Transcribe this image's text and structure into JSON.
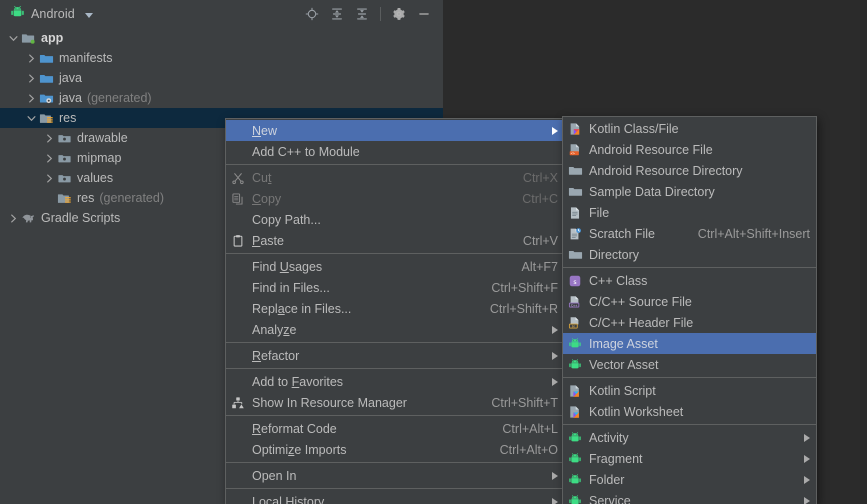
{
  "theme": {
    "tool_window_bg": "#3c3f41",
    "editor_bg": "#2b2b2b",
    "menu_bg": "#3c3f41",
    "menu_border": "#5e6060",
    "highlight_blue": "#4b6eaf",
    "tree_selection_unfocused": "#0d293e",
    "text": "#bbbbbb",
    "text_disabled": "#777777",
    "android_green": "#3ddc84",
    "folder_blue": "#4e94ce"
  },
  "tool_window": {
    "title": "Android",
    "title_icon": "android-robot-icon",
    "dropdown_icon": "chevron-down-icon",
    "toolbar": [
      {
        "name": "locate-icon",
        "tooltip": "Select Opened File"
      },
      {
        "name": "expand-all-icon",
        "tooltip": "Expand All"
      },
      {
        "name": "collapse-all-icon",
        "tooltip": "Collapse All"
      },
      {
        "name": "gear-icon",
        "tooltip": "Settings"
      },
      {
        "name": "minimize-icon",
        "tooltip": "Hide"
      }
    ]
  },
  "tree": [
    {
      "label": "app",
      "sub": "",
      "depth": 0,
      "arrow": "expanded",
      "icon": "module-folder-icon",
      "bold": true,
      "selected": false
    },
    {
      "label": "manifests",
      "sub": "",
      "depth": 1,
      "arrow": "collapsed",
      "icon": "folder-blue-icon",
      "bold": false,
      "selected": false
    },
    {
      "label": "java",
      "sub": "",
      "depth": 1,
      "arrow": "collapsed",
      "icon": "folder-blue-icon",
      "bold": false,
      "selected": false
    },
    {
      "label": "java",
      "sub": "(generated)",
      "depth": 1,
      "arrow": "collapsed",
      "icon": "folder-generated-icon",
      "bold": false,
      "selected": false
    },
    {
      "label": "res",
      "sub": "",
      "depth": 1,
      "arrow": "expanded",
      "icon": "folder-res-icon",
      "bold": false,
      "selected": true
    },
    {
      "label": "drawable",
      "sub": "",
      "depth": 2,
      "arrow": "collapsed",
      "icon": "folder-resource-icon",
      "bold": false,
      "selected": false
    },
    {
      "label": "mipmap",
      "sub": "",
      "depth": 2,
      "arrow": "collapsed",
      "icon": "folder-resource-icon",
      "bold": false,
      "selected": false
    },
    {
      "label": "values",
      "sub": "",
      "depth": 2,
      "arrow": "collapsed",
      "icon": "folder-resource-icon",
      "bold": false,
      "selected": false
    },
    {
      "label": "res",
      "sub": "(generated)",
      "depth": 2,
      "arrow": "none",
      "icon": "folder-res-generated-icon",
      "bold": false,
      "selected": false
    },
    {
      "label": "Gradle Scripts",
      "sub": "",
      "depth": 0,
      "arrow": "collapsed",
      "icon": "gradle-elephant-icon",
      "bold": false,
      "selected": false
    }
  ],
  "context_menu": [
    {
      "label": "New",
      "accel": "",
      "icon": "",
      "arrow": true,
      "highlight": true,
      "disabled": false,
      "mnemonic": "N"
    },
    {
      "label": "Add C++ to Module",
      "accel": "",
      "icon": "",
      "arrow": false,
      "highlight": false,
      "disabled": false
    },
    {
      "separator": true
    },
    {
      "label": "Cut",
      "accel": "Ctrl+X",
      "icon": "scissors-icon",
      "arrow": false,
      "highlight": false,
      "disabled": true,
      "mnemonic": "t"
    },
    {
      "label": "Copy",
      "accel": "Ctrl+C",
      "icon": "copy-icon",
      "arrow": false,
      "highlight": false,
      "disabled": true,
      "mnemonic": "C"
    },
    {
      "label": "Copy Path...",
      "accel": "",
      "icon": "",
      "arrow": false,
      "highlight": false,
      "disabled": false
    },
    {
      "label": "Paste",
      "accel": "Ctrl+V",
      "icon": "clipboard-icon",
      "arrow": false,
      "highlight": false,
      "disabled": false,
      "mnemonic": "P"
    },
    {
      "separator": true
    },
    {
      "label": "Find Usages",
      "accel": "Alt+F7",
      "icon": "",
      "arrow": false,
      "highlight": false,
      "disabled": false,
      "mnemonic": "U"
    },
    {
      "label": "Find in Files...",
      "accel": "Ctrl+Shift+F",
      "icon": "",
      "arrow": false,
      "highlight": false,
      "disabled": false
    },
    {
      "label": "Replace in Files...",
      "accel": "Ctrl+Shift+R",
      "icon": "",
      "arrow": false,
      "highlight": false,
      "disabled": false,
      "mnemonic": "a"
    },
    {
      "label": "Analyze",
      "accel": "",
      "icon": "",
      "arrow": true,
      "highlight": false,
      "disabled": false,
      "mnemonic": "z"
    },
    {
      "separator": true
    },
    {
      "label": "Refactor",
      "accel": "",
      "icon": "",
      "arrow": true,
      "highlight": false,
      "disabled": false,
      "mnemonic": "R"
    },
    {
      "separator": true
    },
    {
      "label": "Add to Favorites",
      "accel": "",
      "icon": "",
      "arrow": true,
      "highlight": false,
      "disabled": false,
      "mnemonic": "F"
    },
    {
      "label": "Show In Resource Manager",
      "accel": "Ctrl+Shift+T",
      "icon": "resource-manager-icon",
      "arrow": false,
      "highlight": false,
      "disabled": false
    },
    {
      "separator": true
    },
    {
      "label": "Reformat Code",
      "accel": "Ctrl+Alt+L",
      "icon": "",
      "arrow": false,
      "highlight": false,
      "disabled": false,
      "mnemonic": "R"
    },
    {
      "label": "Optimize Imports",
      "accel": "Ctrl+Alt+O",
      "icon": "",
      "arrow": false,
      "highlight": false,
      "disabled": false,
      "mnemonic": "z"
    },
    {
      "separator": true
    },
    {
      "label": "Open In",
      "accel": "",
      "icon": "",
      "arrow": true,
      "highlight": false,
      "disabled": false
    },
    {
      "separator": true
    },
    {
      "label": "Local History",
      "accel": "",
      "icon": "",
      "arrow": true,
      "highlight": false,
      "disabled": false,
      "mnemonic": "H"
    }
  ],
  "new_submenu": [
    {
      "label": "Kotlin Class/File",
      "accel": "",
      "icon": "kotlin-file-icon",
      "arrow": false,
      "highlight": false
    },
    {
      "label": "Android Resource File",
      "accel": "",
      "icon": "android-resource-file-icon",
      "arrow": false,
      "highlight": false
    },
    {
      "label": "Android Resource Directory",
      "accel": "",
      "icon": "folder-icon",
      "arrow": false,
      "highlight": false
    },
    {
      "label": "Sample Data Directory",
      "accel": "",
      "icon": "folder-icon",
      "arrow": false,
      "highlight": false
    },
    {
      "label": "File",
      "accel": "",
      "icon": "file-icon",
      "arrow": false,
      "highlight": false
    },
    {
      "label": "Scratch File",
      "accel": "Ctrl+Alt+Shift+Insert",
      "icon": "scratch-file-icon",
      "arrow": false,
      "highlight": false
    },
    {
      "label": "Directory",
      "accel": "",
      "icon": "folder-icon",
      "arrow": false,
      "highlight": false
    },
    {
      "separator": true
    },
    {
      "label": "C++ Class",
      "accel": "",
      "icon": "cpp-class-icon",
      "arrow": false,
      "highlight": false
    },
    {
      "label": "C/C++ Source File",
      "accel": "",
      "icon": "cpp-source-icon",
      "arrow": false,
      "highlight": false
    },
    {
      "label": "C/C++ Header File",
      "accel": "",
      "icon": "cpp-header-icon",
      "arrow": false,
      "highlight": false
    },
    {
      "label": "Image Asset",
      "accel": "",
      "icon": "android-robot-icon",
      "arrow": false,
      "highlight": true
    },
    {
      "label": "Vector Asset",
      "accel": "",
      "icon": "android-robot-icon",
      "arrow": false,
      "highlight": false
    },
    {
      "separator": true
    },
    {
      "label": "Kotlin Script",
      "accel": "",
      "icon": "kotlin-script-icon",
      "arrow": false,
      "highlight": false
    },
    {
      "label": "Kotlin Worksheet",
      "accel": "",
      "icon": "kotlin-script-icon",
      "arrow": false,
      "highlight": false
    },
    {
      "separator": true
    },
    {
      "label": "Activity",
      "accel": "",
      "icon": "android-robot-icon",
      "arrow": true,
      "highlight": false
    },
    {
      "label": "Fragment",
      "accel": "",
      "icon": "android-robot-icon",
      "arrow": true,
      "highlight": false
    },
    {
      "label": "Folder",
      "accel": "",
      "icon": "android-robot-icon",
      "arrow": true,
      "highlight": false
    },
    {
      "label": "Service",
      "accel": "",
      "icon": "android-robot-icon",
      "arrow": true,
      "highlight": false
    }
  ]
}
